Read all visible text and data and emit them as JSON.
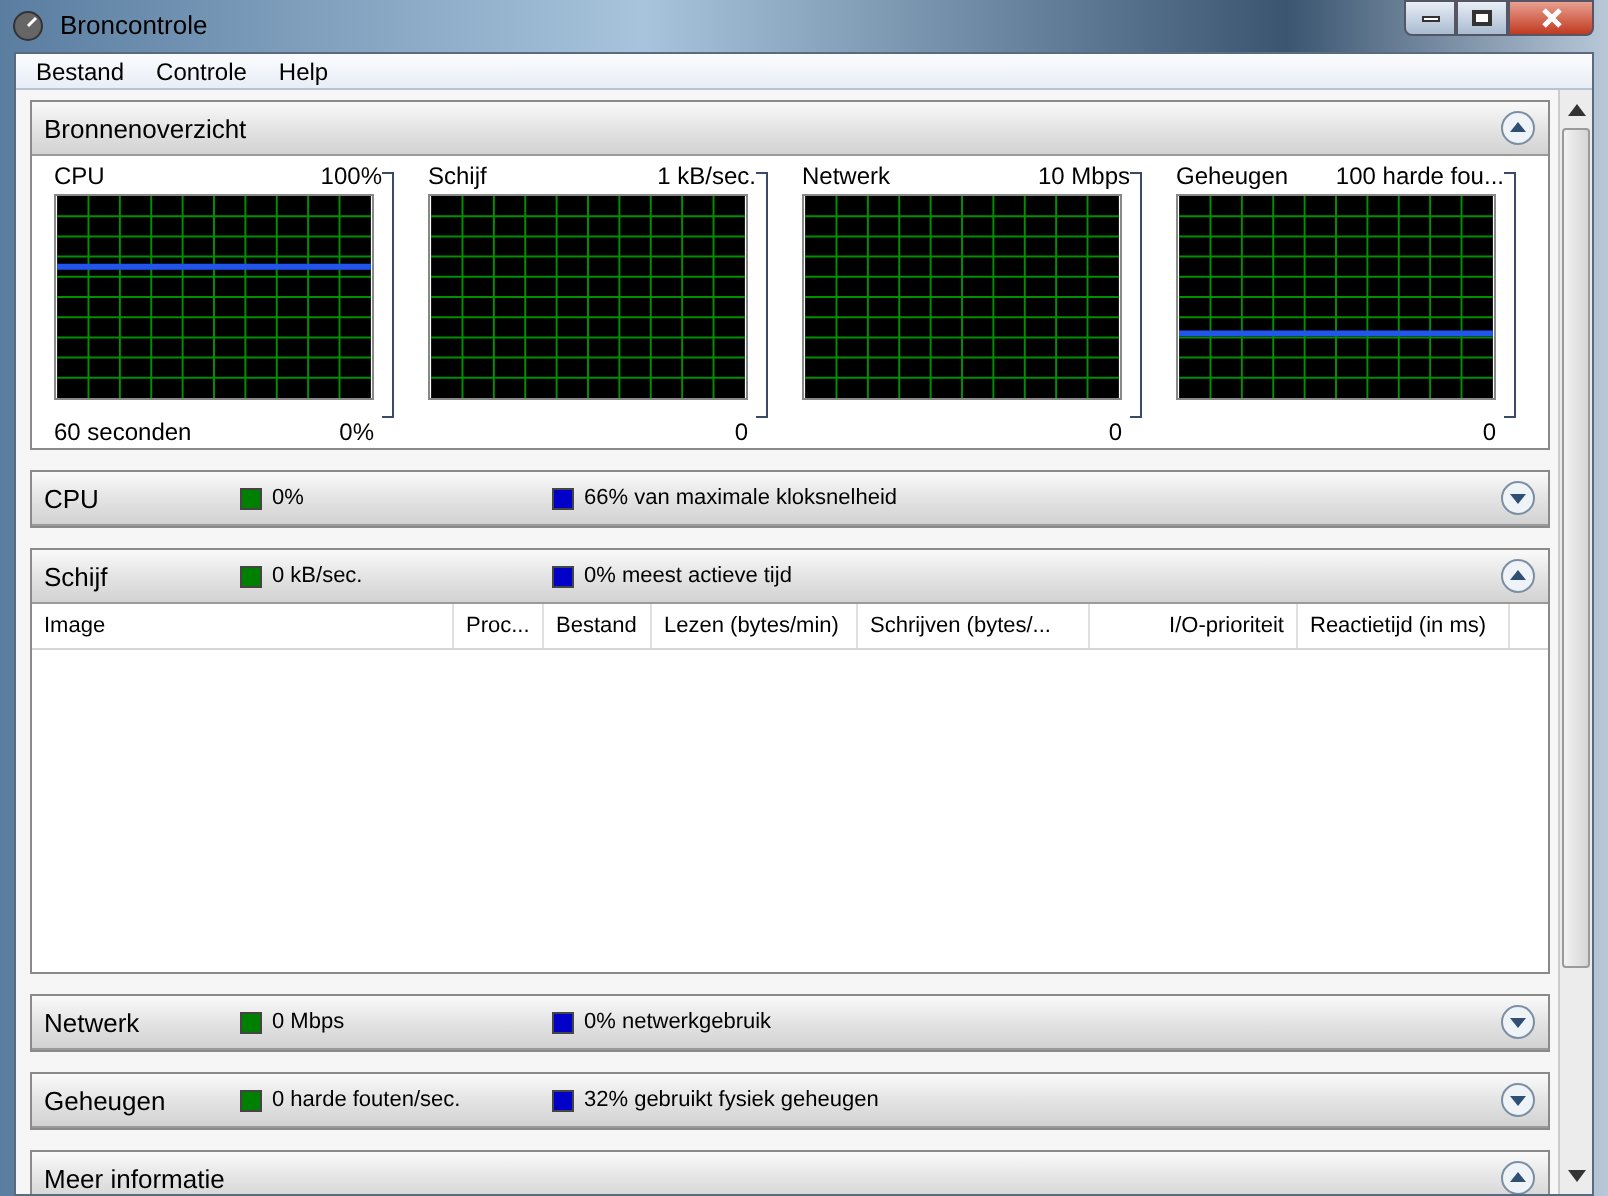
{
  "window": {
    "title": "Broncontrole"
  },
  "menu": [
    "Bestand",
    "Controle",
    "Help"
  ],
  "overview": {
    "title": "Bronnenoverzicht",
    "expanded": true,
    "graphs": [
      {
        "name": "CPU",
        "max": "100%",
        "min": "0%",
        "time": "60 seconden"
      },
      {
        "name": "Schijf",
        "max": "1 kB/sec.",
        "min": "0"
      },
      {
        "name": "Netwerk",
        "max": "10 Mbps",
        "min": "0"
      },
      {
        "name": "Geheugen",
        "max": "100 harde fou...",
        "min": "0"
      }
    ]
  },
  "sections": [
    {
      "title": "CPU",
      "expanded": false,
      "stats": [
        {
          "text": "0%",
          "color": "#008000"
        },
        {
          "text": "66% van maximale kloksnelheid",
          "color": "#0000c8"
        }
      ]
    },
    {
      "title": "Schijf",
      "expanded": true,
      "stats": [
        {
          "text": "0 kB/sec.",
          "color": "#008000"
        },
        {
          "text": "0% meest actieve tijd",
          "color": "#0000c8"
        }
      ],
      "table": {
        "columns": [
          "Image",
          "Proc...",
          "Bestand",
          "Lezen (bytes/min)",
          "Schrijven (bytes/...",
          "I/O-prioriteit",
          "Reactietijd (in ms)"
        ]
      }
    },
    {
      "title": "Netwerk",
      "expanded": false,
      "stats": [
        {
          "text": "0 Mbps",
          "color": "#008000"
        },
        {
          "text": "0% netwerkgebruik",
          "color": "#0000c8"
        }
      ]
    },
    {
      "title": "Geheugen",
      "expanded": false,
      "stats": [
        {
          "text": "0 harde fouten/sec.",
          "color": "#008000"
        },
        {
          "text": "32% gebruikt fysiek geheugen",
          "color": "#0000c8"
        }
      ]
    },
    {
      "title": "Meer informatie",
      "expanded": true
    }
  ]
}
